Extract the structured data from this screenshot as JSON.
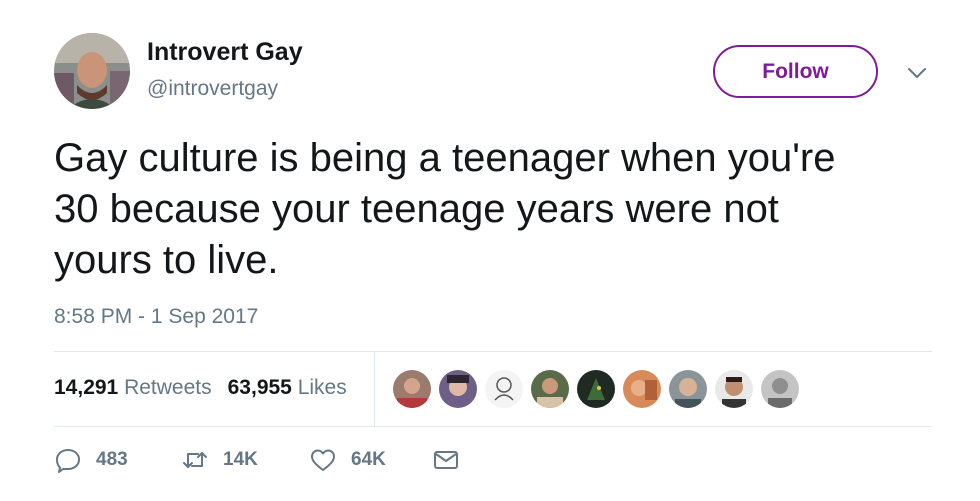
{
  "author": {
    "name": "Introvert Gay",
    "handle": "@introvertgay",
    "avatar_icon": "profile-photo"
  },
  "follow_label": "Follow",
  "tweet": {
    "text_lines": [
      "Gay culture is being a teenager when you're",
      "30 because your teenage years were not",
      "yours to live."
    ],
    "timestamp": "8:58 PM - 1 Sep 2017"
  },
  "stats": {
    "retweets_count": "14,291",
    "retweets_label": "Retweets",
    "likes_count": "63,955",
    "likes_label": "Likes"
  },
  "actions": {
    "reply_count": "483",
    "retweet_count": "14K",
    "like_count": "64K"
  },
  "colors": {
    "accent": "#7f1b9a",
    "secondary_text": "#657786",
    "divider": "#e1e8ed"
  }
}
